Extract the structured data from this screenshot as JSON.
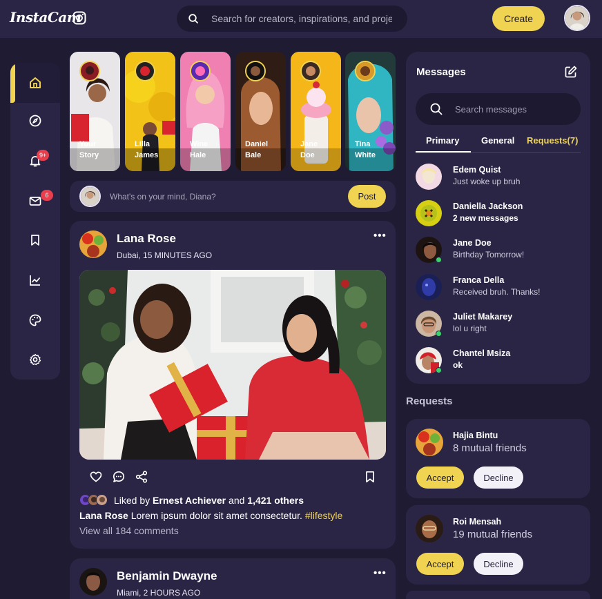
{
  "app": {
    "logo_text": "InstaCam",
    "search_placeholder": "Search for creators, inspirations, and projects",
    "create_label": "Create"
  },
  "colors": {
    "accent": "#efd351",
    "background": "#1f1b33",
    "panel": "#2b2545",
    "badge": "#e83f4f",
    "online": "#3ad36b"
  },
  "rail": {
    "items": [
      {
        "icon": "home-icon",
        "active": true
      },
      {
        "icon": "compass-icon"
      },
      {
        "icon": "bell-icon",
        "badge": "9+"
      },
      {
        "icon": "mail-icon",
        "badge": "6"
      },
      {
        "icon": "bookmark-icon"
      },
      {
        "icon": "chart-icon"
      },
      {
        "icon": "palette-icon"
      },
      {
        "icon": "settings-icon"
      }
    ]
  },
  "stories": [
    {
      "line1": "Your",
      "line2": "Story"
    },
    {
      "line1": "Lilla",
      "line2": "James"
    },
    {
      "line1": "Wine",
      "line2": "Hale"
    },
    {
      "line1": "Daniel",
      "line2": "Bale"
    },
    {
      "line1": "Jane",
      "line2": "Doe"
    },
    {
      "line1": "Tina",
      "line2": "White"
    }
  ],
  "composer": {
    "placeholder": "What's on your mind, Diana?",
    "post_label": "Post"
  },
  "feed": [
    {
      "name": "Lana Rose",
      "meta": "Dubai, 15 MINUTES AGO",
      "more": "•••",
      "liked_prefix": "Liked by",
      "liked_user": "Ernest Achiever",
      "liked_and": "and",
      "liked_count": "1,421 others",
      "caption_user": "Lana Rose",
      "caption_text": "Lorem ipsum dolor sit amet consectetur.",
      "caption_tag": "#lifestyle",
      "view_all": "View all 184 comments"
    },
    {
      "name": "Benjamin Dwayne",
      "meta": "Miami, 2 HOURS AGO",
      "more": "•••"
    }
  ],
  "messages": {
    "title": "Messages",
    "search_placeholder": "Search messages",
    "tabs": [
      "Primary",
      "General",
      "Requests(7)"
    ],
    "items": [
      {
        "name": "Edem Quist",
        "text": "Just woke up bruh",
        "online": false,
        "bold": false
      },
      {
        "name": "Daniella Jackson",
        "text": "2 new messages",
        "online": false,
        "bold": true
      },
      {
        "name": "Jane Doe",
        "text": "Birthday Tomorrow!",
        "online": true,
        "bold": false
      },
      {
        "name": "Franca Della",
        "text": "Received bruh. Thanks!",
        "online": false,
        "bold": false
      },
      {
        "name": "Juliet Makarey",
        "text": "lol u right",
        "online": true,
        "bold": false
      },
      {
        "name": "Chantel Msiza",
        "text": "ok",
        "online": true,
        "bold": true
      }
    ]
  },
  "requests": {
    "heading": "Requests",
    "items": [
      {
        "name": "Hajia Bintu",
        "mutual": "8 mutual friends",
        "accept": "Accept",
        "decline": "Decline"
      },
      {
        "name": "Roi Mensah",
        "mutual": "19 mutual friends",
        "accept": "Accept",
        "decline": "Decline"
      }
    ]
  }
}
